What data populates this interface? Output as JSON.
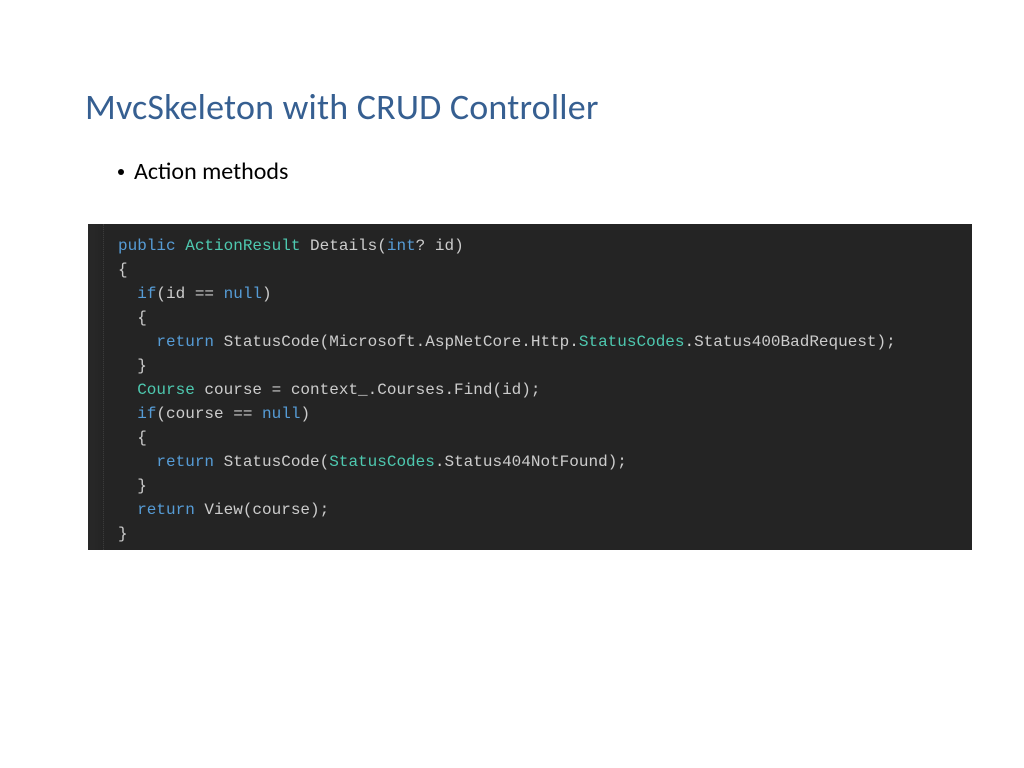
{
  "title": "MvcSkeleton with CRUD Controller",
  "bullet": "Action methods",
  "code": {
    "l1_public": "public",
    "l1_ar": "ActionResult",
    "l1_det": "Details(",
    "l1_int": "int",
    "l1_qid": "? id)",
    "l2_brace": "{",
    "l3_if": "if",
    "l3_cond": "(id == ",
    "l3_null": "null",
    "l3_close": ")",
    "l4_brace": "{",
    "l5_return": "return",
    "l5_stat": " StatusCode(Microsoft.AspNetCore.Http.",
    "l5_sc": "StatusCodes",
    "l5_rest": ".Status400BadRequest);",
    "l6_brace": "}",
    "l7_course": "Course",
    "l7_rest": " course = context_.Courses.Find(id);",
    "l8_if": "if",
    "l8_cond": "(course == ",
    "l8_null": "null",
    "l8_close": ")",
    "l9_brace": "{",
    "l10_return": "return",
    "l10_stat": " StatusCode(",
    "l10_sc": "StatusCodes",
    "l10_rest": ".Status404NotFound);",
    "l11_brace": "}",
    "l12_return": "return",
    "l12_rest": " View(course);",
    "l13_brace": "}"
  }
}
